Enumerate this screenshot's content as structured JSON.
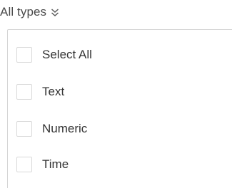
{
  "filter": {
    "label": "All types",
    "icon": "double-chevron-down-icon"
  },
  "options": [
    {
      "label": "Select All",
      "checked": false
    },
    {
      "label": "Text",
      "checked": false
    },
    {
      "label": "Numeric",
      "checked": false
    },
    {
      "label": "Time",
      "checked": false
    }
  ],
  "colors": {
    "text": "#333333",
    "trigger_text": "#4a4a4a",
    "border": "#d5d5d5",
    "checkbox_border": "#d9d9d9"
  }
}
